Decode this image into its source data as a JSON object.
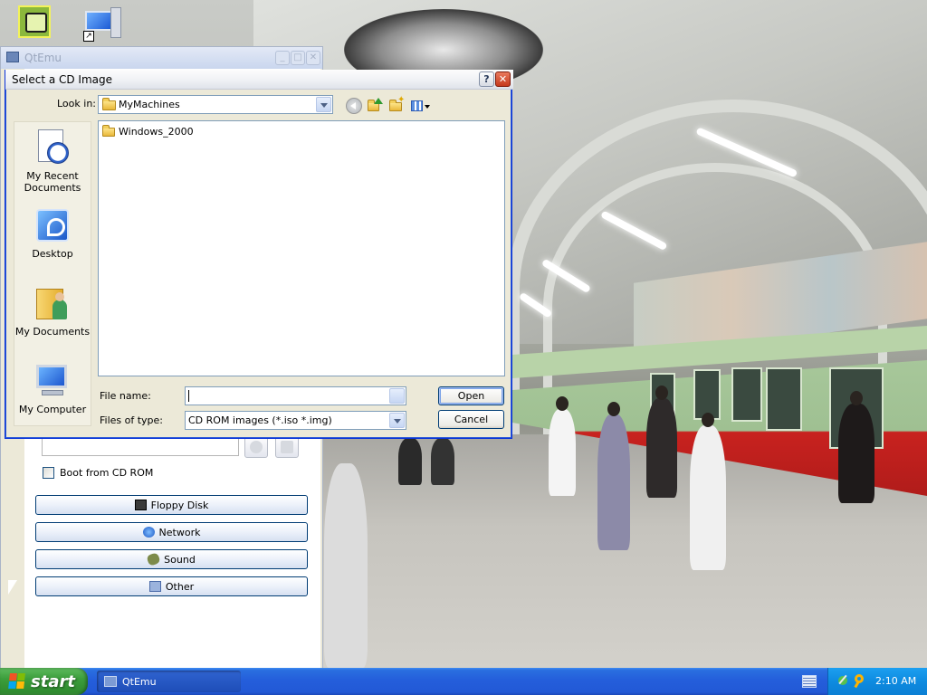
{
  "qtemu_window": {
    "title": "QtEmu",
    "minimize": "_",
    "maximize": "□",
    "close": "✕",
    "boot_from_cd_label": "Boot from CD ROM",
    "buttons": {
      "floppy": "Floppy Disk",
      "network": "Network",
      "sound": "Sound",
      "other": "Other"
    }
  },
  "dialog": {
    "title": "Select a CD Image",
    "help": "?",
    "close": "✕",
    "look_in_label": "Look in:",
    "look_in_value": "MyMachines",
    "places": [
      {
        "label": "My Recent Documents"
      },
      {
        "label": "Desktop"
      },
      {
        "label": "My Documents"
      },
      {
        "label": "My Computer"
      }
    ],
    "files": [
      {
        "name": "Windows_2000",
        "type": "folder"
      }
    ],
    "file_name_label": "File name:",
    "file_name_value": "",
    "files_of_type_label": "Files of type:",
    "files_of_type_value": "CD ROM images (*.iso *.img)",
    "open_label": "Open",
    "cancel_label": "Cancel"
  },
  "taskbar": {
    "start_label": "start",
    "tasks": [
      {
        "label": "QtEmu"
      }
    ],
    "clock": "2:10 AM"
  },
  "colors": {
    "taskbar_blue": "#245edb",
    "start_green": "#3c9e3c",
    "tray_blue": "#0e8be0",
    "dialog_bg": "#ece9d8",
    "train_green": "#9fc092",
    "train_red": "#c8221f"
  }
}
